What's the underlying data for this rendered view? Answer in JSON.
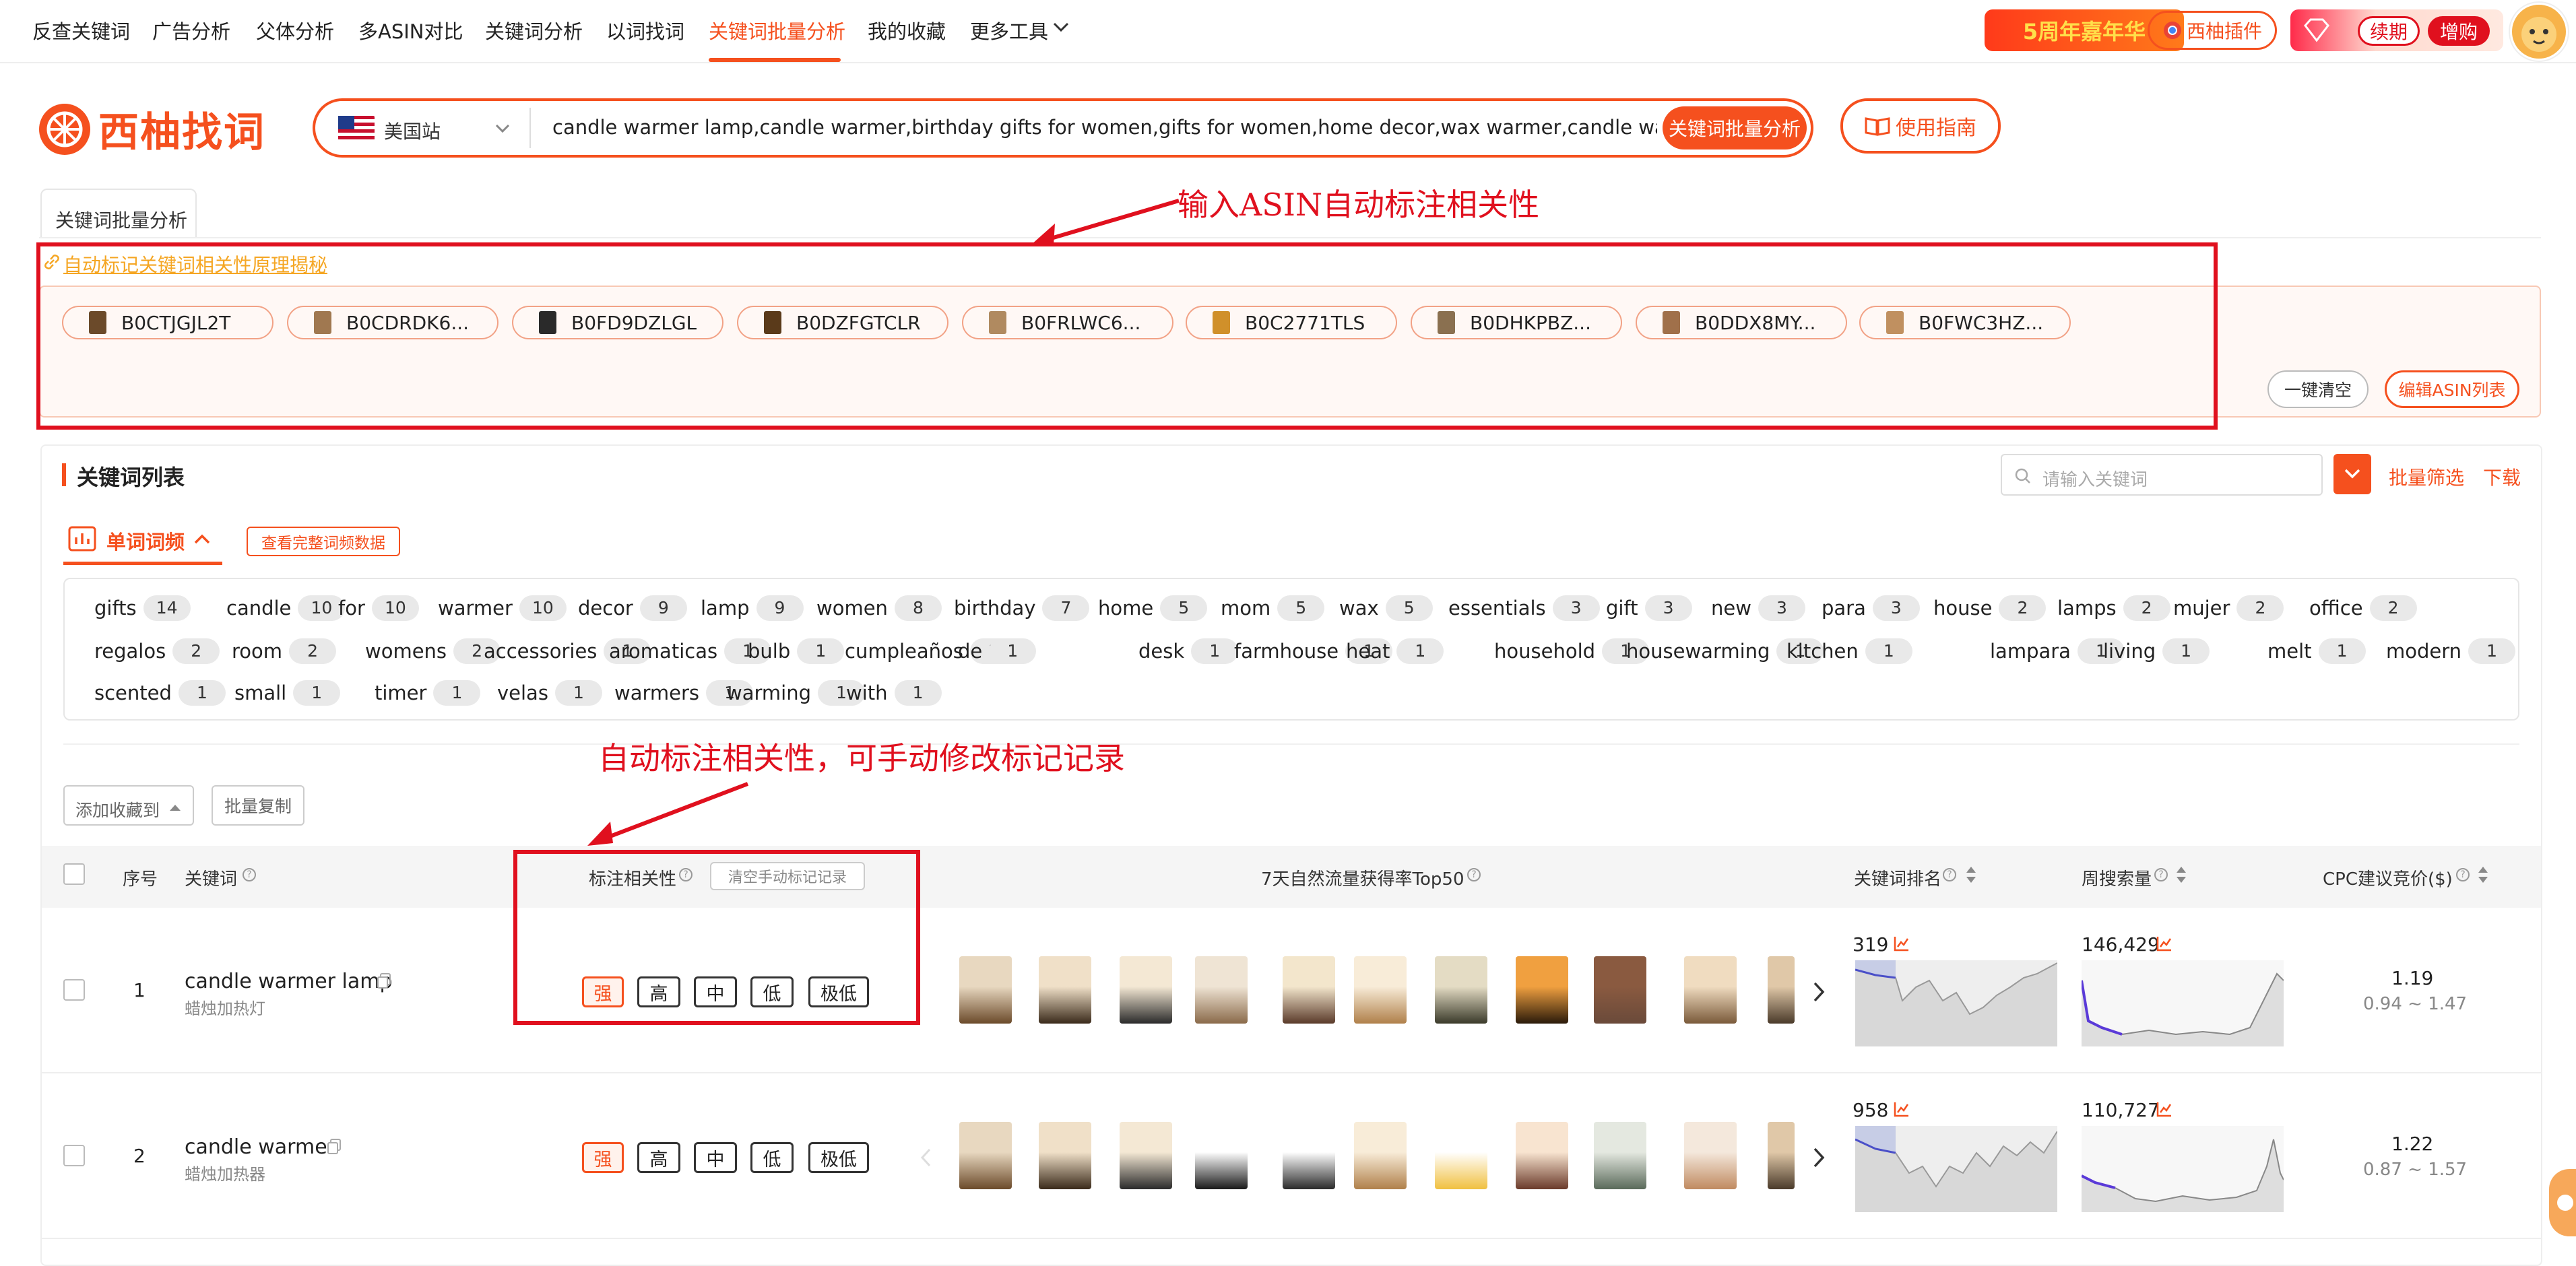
{
  "nav": {
    "items": [
      "反查关键词",
      "广告分析",
      "父体分析",
      "多ASIN对比",
      "关键词分析",
      "以词找词",
      "关键词批量分析",
      "我的收藏",
      "更多工具"
    ],
    "active_index": 6,
    "promo_anniv": "5周年嘉年华",
    "plugin_label": "西柚插件",
    "renew_label": "续期",
    "add_label": "增购"
  },
  "brand": {
    "logo_text": "西柚找词"
  },
  "search": {
    "site": "美国站",
    "query": "candle warmer lamp,candle warmer,birthday gifts for women,gifts for women,home decor,wax warmer,candle warmer lamp",
    "submit_label": "关键词批量分析",
    "guide_label": "使用指南"
  },
  "tab_label": "关键词批量分析",
  "principle_link": "自动标记关键词相关性原理揭秘",
  "asins": [
    "B0CTJGJL2T",
    "B0CDRDK6...",
    "B0FD9DZLGL",
    "B0DZFGTCLR",
    "B0FRLWC6...",
    "B0C2771TLS",
    "B0DHKPBZ...",
    "B0DDX8MY...",
    "B0FWC3HZ..."
  ],
  "asin_actions": {
    "clear_label": "一键清空",
    "edit_label": "编辑ASIN列表"
  },
  "keyword_list": {
    "title": "关键词列表",
    "search_placeholder": "请输入关键词",
    "batch_filter_label": "批量筛选",
    "download_label": "下载",
    "freq_tab_label": "单词词频",
    "view_full_label": "查看完整词频数据"
  },
  "word_freq": [
    {
      "w": "gifts",
      "c": "14"
    },
    {
      "w": "candle",
      "c": "10"
    },
    {
      "w": "for",
      "c": "10"
    },
    {
      "w": "warmer",
      "c": "10"
    },
    {
      "w": "decor",
      "c": "9"
    },
    {
      "w": "lamp",
      "c": "9"
    },
    {
      "w": "women",
      "c": "8"
    },
    {
      "w": "birthday",
      "c": "7"
    },
    {
      "w": "home",
      "c": "5"
    },
    {
      "w": "mom",
      "c": "5"
    },
    {
      "w": "wax",
      "c": "5"
    },
    {
      "w": "essentials",
      "c": "3"
    },
    {
      "w": "gift",
      "c": "3"
    },
    {
      "w": "new",
      "c": "3"
    },
    {
      "w": "para",
      "c": "3"
    },
    {
      "w": "house",
      "c": "2"
    },
    {
      "w": "lamps",
      "c": "2"
    },
    {
      "w": "mujer",
      "c": "2"
    },
    {
      "w": "office",
      "c": "2"
    },
    {
      "w": "regalos",
      "c": "2"
    },
    {
      "w": "room",
      "c": "2"
    },
    {
      "w": "womens",
      "c": "2"
    },
    {
      "w": "accessories",
      "c": "1"
    },
    {
      "w": "aromaticas",
      "c": "1"
    },
    {
      "w": "bulb",
      "c": "1"
    },
    {
      "w": "cumpleaños",
      "c": "1"
    },
    {
      "w": "de",
      "c": "1"
    },
    {
      "w": "desk",
      "c": "1"
    },
    {
      "w": "farmhouse",
      "c": "1"
    },
    {
      "w": "heat",
      "c": "1"
    },
    {
      "w": "household",
      "c": "1"
    },
    {
      "w": "housewarming",
      "c": "1"
    },
    {
      "w": "kitchen",
      "c": "1"
    },
    {
      "w": "lampara",
      "c": "1"
    },
    {
      "w": "living",
      "c": "1"
    },
    {
      "w": "melt",
      "c": "1"
    },
    {
      "w": "modern",
      "c": "1"
    },
    {
      "w": "scented",
      "c": "1"
    },
    {
      "w": "small",
      "c": "1"
    },
    {
      "w": "timer",
      "c": "1"
    },
    {
      "w": "velas",
      "c": "1"
    },
    {
      "w": "warmers",
      "c": "1"
    },
    {
      "w": "warming",
      "c": "1"
    },
    {
      "w": "with",
      "c": "1"
    }
  ],
  "actions": {
    "add_fav_label": "添加收藏到",
    "batch_copy_label": "批量复制"
  },
  "table": {
    "headers": {
      "index": "序号",
      "keyword": "关键词",
      "relevance": "标注相关性",
      "clear_manual": "清空手动标记记录",
      "top50": "7天自然流量获得率Top50",
      "rank": "关键词排名",
      "weekly": "周搜索量",
      "cpc": "CPC建议竞价($)"
    },
    "relevance_levels": [
      "强",
      "高",
      "中",
      "低",
      "极低"
    ],
    "rows": [
      {
        "index": "1",
        "keyword": "candle warmer lamp",
        "translation": "蜡烛加热灯",
        "rank": "319",
        "weekly": "146,429",
        "cpc": "1.19",
        "cpc_range": "0.94 ~ 1.47"
      },
      {
        "index": "2",
        "keyword": "candle warmer",
        "translation": "蜡烛加热器",
        "rank": "958",
        "weekly": "110,727",
        "cpc": "1.22",
        "cpc_range": "0.87 ~ 1.57"
      }
    ]
  },
  "annotations": {
    "asin_note": "输入ASIN自动标注相关性",
    "relevance_note": "自动标注相关性，可手动修改标记记录"
  },
  "colors": {
    "accent": "#f5501e",
    "annotation": "#e0101e"
  }
}
